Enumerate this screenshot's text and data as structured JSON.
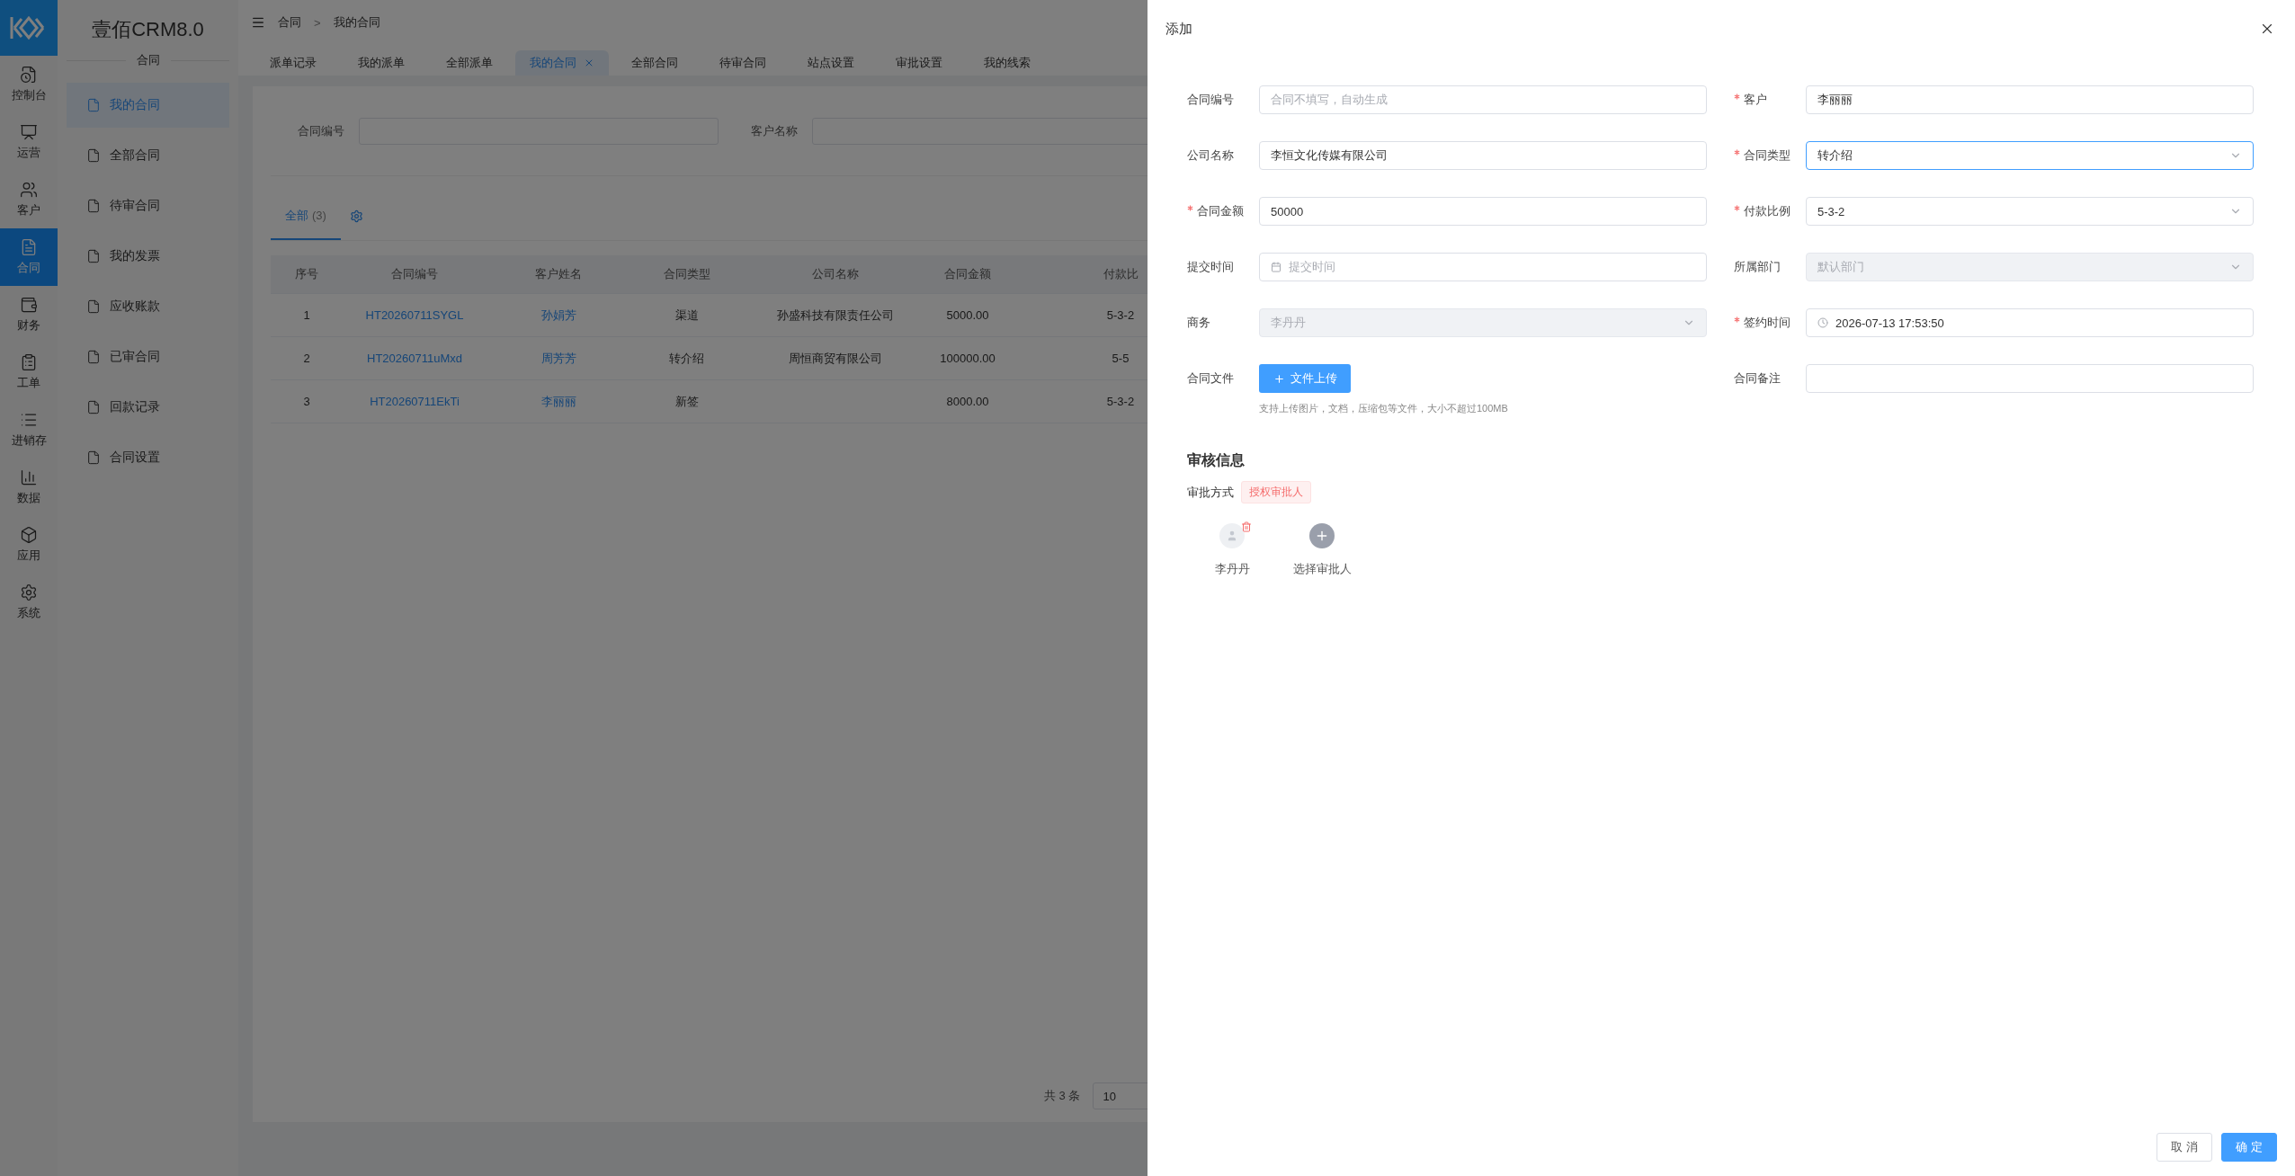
{
  "rail": {
    "items": [
      {
        "label": "控制台",
        "selected": false
      },
      {
        "label": "运营",
        "selected": false
      },
      {
        "label": "客户",
        "selected": false
      },
      {
        "label": "合同",
        "selected": true
      },
      {
        "label": "财务",
        "selected": false
      },
      {
        "label": "工单",
        "selected": false
      },
      {
        "label": "进销存",
        "selected": false
      },
      {
        "label": "数据",
        "selected": false
      },
      {
        "label": "应用",
        "selected": false
      },
      {
        "label": "系统",
        "selected": false
      }
    ]
  },
  "submenu": {
    "title": "壹佰CRM8.0",
    "heading": "合同",
    "items": [
      {
        "label": "我的合同",
        "selected": true
      },
      {
        "label": "全部合同",
        "selected": false
      },
      {
        "label": "待审合同",
        "selected": false
      },
      {
        "label": "我的发票",
        "selected": false
      },
      {
        "label": "应收账款",
        "selected": false
      },
      {
        "label": "已审合同",
        "selected": false
      },
      {
        "label": "回款记录",
        "selected": false
      },
      {
        "label": "合同设置",
        "selected": false
      }
    ]
  },
  "breadcrumb": {
    "items": [
      "合同",
      "我的合同"
    ],
    "separator": ">"
  },
  "page_tabs": [
    {
      "label": "派单记录",
      "selected": false
    },
    {
      "label": "我的派单",
      "selected": false
    },
    {
      "label": "全部派单",
      "selected": false
    },
    {
      "label": "我的合同",
      "selected": true
    },
    {
      "label": "全部合同",
      "selected": false
    },
    {
      "label": "待审合同",
      "selected": false
    },
    {
      "label": "站点设置",
      "selected": false
    },
    {
      "label": "审批设置",
      "selected": false
    },
    {
      "label": "我的线索",
      "selected": false
    }
  ],
  "filters": [
    {
      "label": "合同编号"
    },
    {
      "label": "客户名称"
    }
  ],
  "list_tabs": [
    {
      "label": "全部",
      "count": "(3)",
      "selected": true
    }
  ],
  "table": {
    "columns": [
      {
        "label": "序号",
        "link": false
      },
      {
        "label": "合同编号",
        "link": true
      },
      {
        "label": "客户姓名",
        "link": true
      },
      {
        "label": "合同类型",
        "link": false
      },
      {
        "label": "公司名称",
        "link": false
      },
      {
        "label": "合同金额",
        "link": false
      },
      {
        "label": "付款比",
        "link": false
      }
    ],
    "rows": [
      [
        "1",
        "HT20260711SYGL",
        "孙娟芳",
        "渠道",
        "孙盛科技有限责任公司",
        "5000.00",
        "5-3-2"
      ],
      [
        "2",
        "HT20260711uMxd",
        "周芳芳",
        "转介绍",
        "周恒商贸有限公司",
        "100000.00",
        "5-5"
      ],
      [
        "3",
        "HT20260711EkTi",
        "李丽丽",
        "新签",
        "",
        "8000.00",
        "5-3-2"
      ]
    ]
  },
  "pagination": {
    "total": "共 3 条",
    "page_size": "10"
  },
  "drawer": {
    "title": "添加",
    "fields": [
      {
        "label": "合同编号",
        "kind": "text",
        "required": false,
        "disabled": false,
        "focused": false,
        "placeholder": "合同不填写，自动生成"
      },
      {
        "label": "客户",
        "kind": "text",
        "required": true,
        "disabled": false,
        "focused": false,
        "value": "李丽丽"
      },
      {
        "label": "公司名称",
        "kind": "text",
        "required": false,
        "disabled": false,
        "focused": false,
        "value": "李恒文化传媒有限公司"
      },
      {
        "label": "合同类型",
        "kind": "select",
        "required": true,
        "disabled": false,
        "focused": true,
        "value": "转介绍"
      },
      {
        "label": "合同金额",
        "kind": "text",
        "required": true,
        "disabled": false,
        "focused": false,
        "value": "50000"
      },
      {
        "label": "付款比例",
        "kind": "select",
        "required": true,
        "disabled": false,
        "focused": false,
        "value": "5-3-2"
      },
      {
        "label": "提交时间",
        "kind": "date",
        "required": false,
        "disabled": false,
        "focused": false,
        "placeholder": "提交时间"
      },
      {
        "label": "所属部门",
        "kind": "select",
        "required": false,
        "disabled": true,
        "focused": false,
        "value": "默认部门"
      },
      {
        "label": "商务",
        "kind": "select",
        "required": false,
        "disabled": true,
        "focused": false,
        "value": "李丹丹"
      },
      {
        "label": "签约时间",
        "kind": "datetime",
        "required": true,
        "disabled": false,
        "focused": false,
        "value": "2026-07-13 17:53:50"
      },
      {
        "label": "合同文件",
        "kind": "upload",
        "required": false,
        "button": "文件上传",
        "hint": "支持上传图片，文档，压缩包等文件，大小不超过100MB"
      },
      {
        "label": "合同备注",
        "kind": "textarea",
        "required": false
      }
    ],
    "review": {
      "heading": "审核信息",
      "method_label": "审批方式",
      "method": "授权审批人",
      "approvers": [
        {
          "kind": "person",
          "name": "李丹丹"
        },
        {
          "kind": "add",
          "name": "选择审批人"
        }
      ]
    },
    "buttons": [
      {
        "label": "取 消",
        "kind": "default"
      },
      {
        "label": "确 定",
        "kind": "primary"
      }
    ]
  }
}
